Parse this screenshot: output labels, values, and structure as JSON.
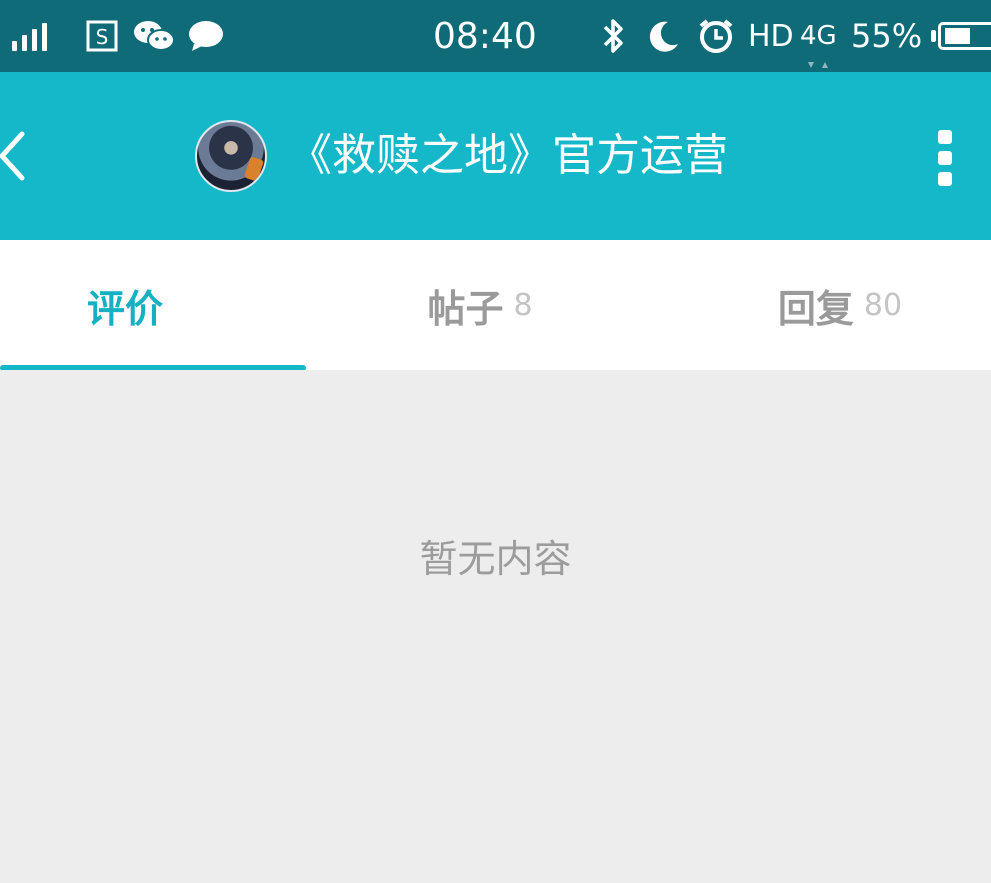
{
  "status_bar": {
    "time": "08:40",
    "hd": "HD",
    "network": "4G",
    "battery": "55%",
    "battery_level": 0.55
  },
  "app_bar": {
    "title": "《救赎之地》官方运营"
  },
  "tabs": [
    {
      "label": "评价",
      "count": ""
    },
    {
      "label": "帖子",
      "count": "8"
    },
    {
      "label": "回复",
      "count": "80"
    }
  ],
  "content": {
    "empty_text": "暂无内容"
  },
  "colors": {
    "status_bar": "#0f6b78",
    "app_bar": "#15b8c8",
    "accent": "#15b0c1"
  }
}
